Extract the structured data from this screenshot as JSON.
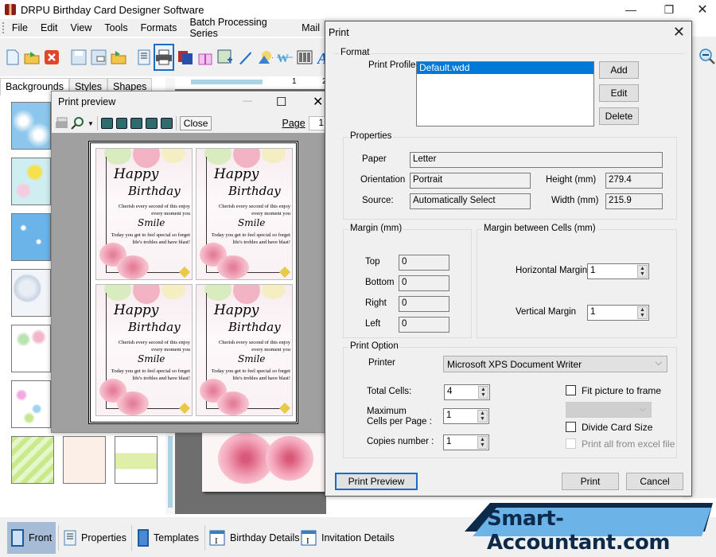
{
  "app": {
    "title": "DRPU Birthday Card Designer Software",
    "window_controls": {
      "minimize": "—",
      "maximize": "❐",
      "close": "✕"
    }
  },
  "menu": [
    "File",
    "Edit",
    "View",
    "Tools",
    "Formats",
    "Batch Processing Series",
    "Mail"
  ],
  "toolbar": {
    "icons": [
      "new-icon",
      "open-icon",
      "close-doc-icon",
      "save-icon",
      "save-as-icon",
      "open-folder-icon",
      "properties-icon",
      "print-icon",
      "gallery-icon",
      "gift-icon",
      "image-icon",
      "pen-icon",
      "shapes-icon",
      "wordart-icon",
      "barcode-icon",
      "text-icon"
    ],
    "selected": "print-icon"
  },
  "left_panel": {
    "tabs": [
      "Backgrounds",
      "Styles",
      "Shapes"
    ],
    "active_tab": "Backgrounds",
    "thumbnails": [
      "clouds",
      "daisies",
      "stars",
      "bubbles",
      "happy-birthday-balloons",
      "hearts",
      "green-stripes",
      "cakes",
      "flower-garden"
    ]
  },
  "ruler": {
    "marks": [
      "1",
      "2"
    ]
  },
  "print_preview": {
    "title": "Print preview",
    "close_label": "Close",
    "page_label": "Page",
    "page_value": "1",
    "controls": {
      "minimize": "—",
      "maximize": "☐",
      "close": "✕"
    },
    "card": {
      "title1": "Happy",
      "title2": "Birthday",
      "line1": "Cherish every second of this enjoy every moment you",
      "smile": "Smile",
      "line2": "Today you get to feel special so forget life's trobles and have blast!"
    },
    "cells": 4
  },
  "print_dialog": {
    "title": "Print",
    "format": {
      "legend": "Format",
      "profile_label": "Print Profile",
      "profiles": [
        "Default.wdd"
      ],
      "selected_profile": "Default.wdd",
      "buttons": {
        "add": "Add",
        "edit": "Edit",
        "delete": "Delete"
      }
    },
    "properties": {
      "legend": "Properties",
      "paper_label": "Paper",
      "paper": "Letter",
      "orientation_label": "Orientation",
      "orientation": "Portrait",
      "source_label": "Source:",
      "source": "Automatically Select",
      "height_label": "Height (mm)",
      "height": "279.4",
      "width_label": "Width (mm)",
      "width": "215.9"
    },
    "margin": {
      "legend": "Margin (mm)",
      "top_label": "Top",
      "top": "0",
      "bottom_label": "Bottom",
      "bottom": "0",
      "right_label": "Right",
      "right": "0",
      "left_label": "Left",
      "left": "0"
    },
    "cell_margin": {
      "legend": "Margin between Cells (mm)",
      "horizontal_label": "Horizontal Margin",
      "horizontal": "1",
      "vertical_label": "Vertical Margin",
      "vertical": "1"
    },
    "print_option": {
      "legend": "Print Option",
      "printer_label": "Printer",
      "printer": "Microsoft XPS Document Writer",
      "total_cells_label": "Total Cells:",
      "total_cells": "4",
      "max_cells_label_1": "Maximum",
      "max_cells_label_2": "Cells per Page :",
      "max_cells": "1",
      "copies_label": "Copies number :",
      "copies": "1",
      "fit_picture_label": "Fit picture to frame",
      "fit_picture": false,
      "divide_card_label": "Divide Card Size",
      "divide_card": false,
      "print_excel_label": "Print all from excel file",
      "print_excel": false
    },
    "buttons": {
      "preview": "Print Preview",
      "print": "Print",
      "cancel": "Cancel"
    }
  },
  "bottom_tabs": [
    {
      "label": "Front",
      "active": true
    },
    {
      "label": "Properties",
      "active": false
    },
    {
      "label": "Templates",
      "active": false
    },
    {
      "label": "Birthday Details",
      "active": false
    },
    {
      "label": "Invitation Details",
      "active": false
    }
  ],
  "brand": {
    "text": "Smart-Accountant.com",
    "fill": "#6cb4e8",
    "text_color": "#0d2a4a"
  }
}
